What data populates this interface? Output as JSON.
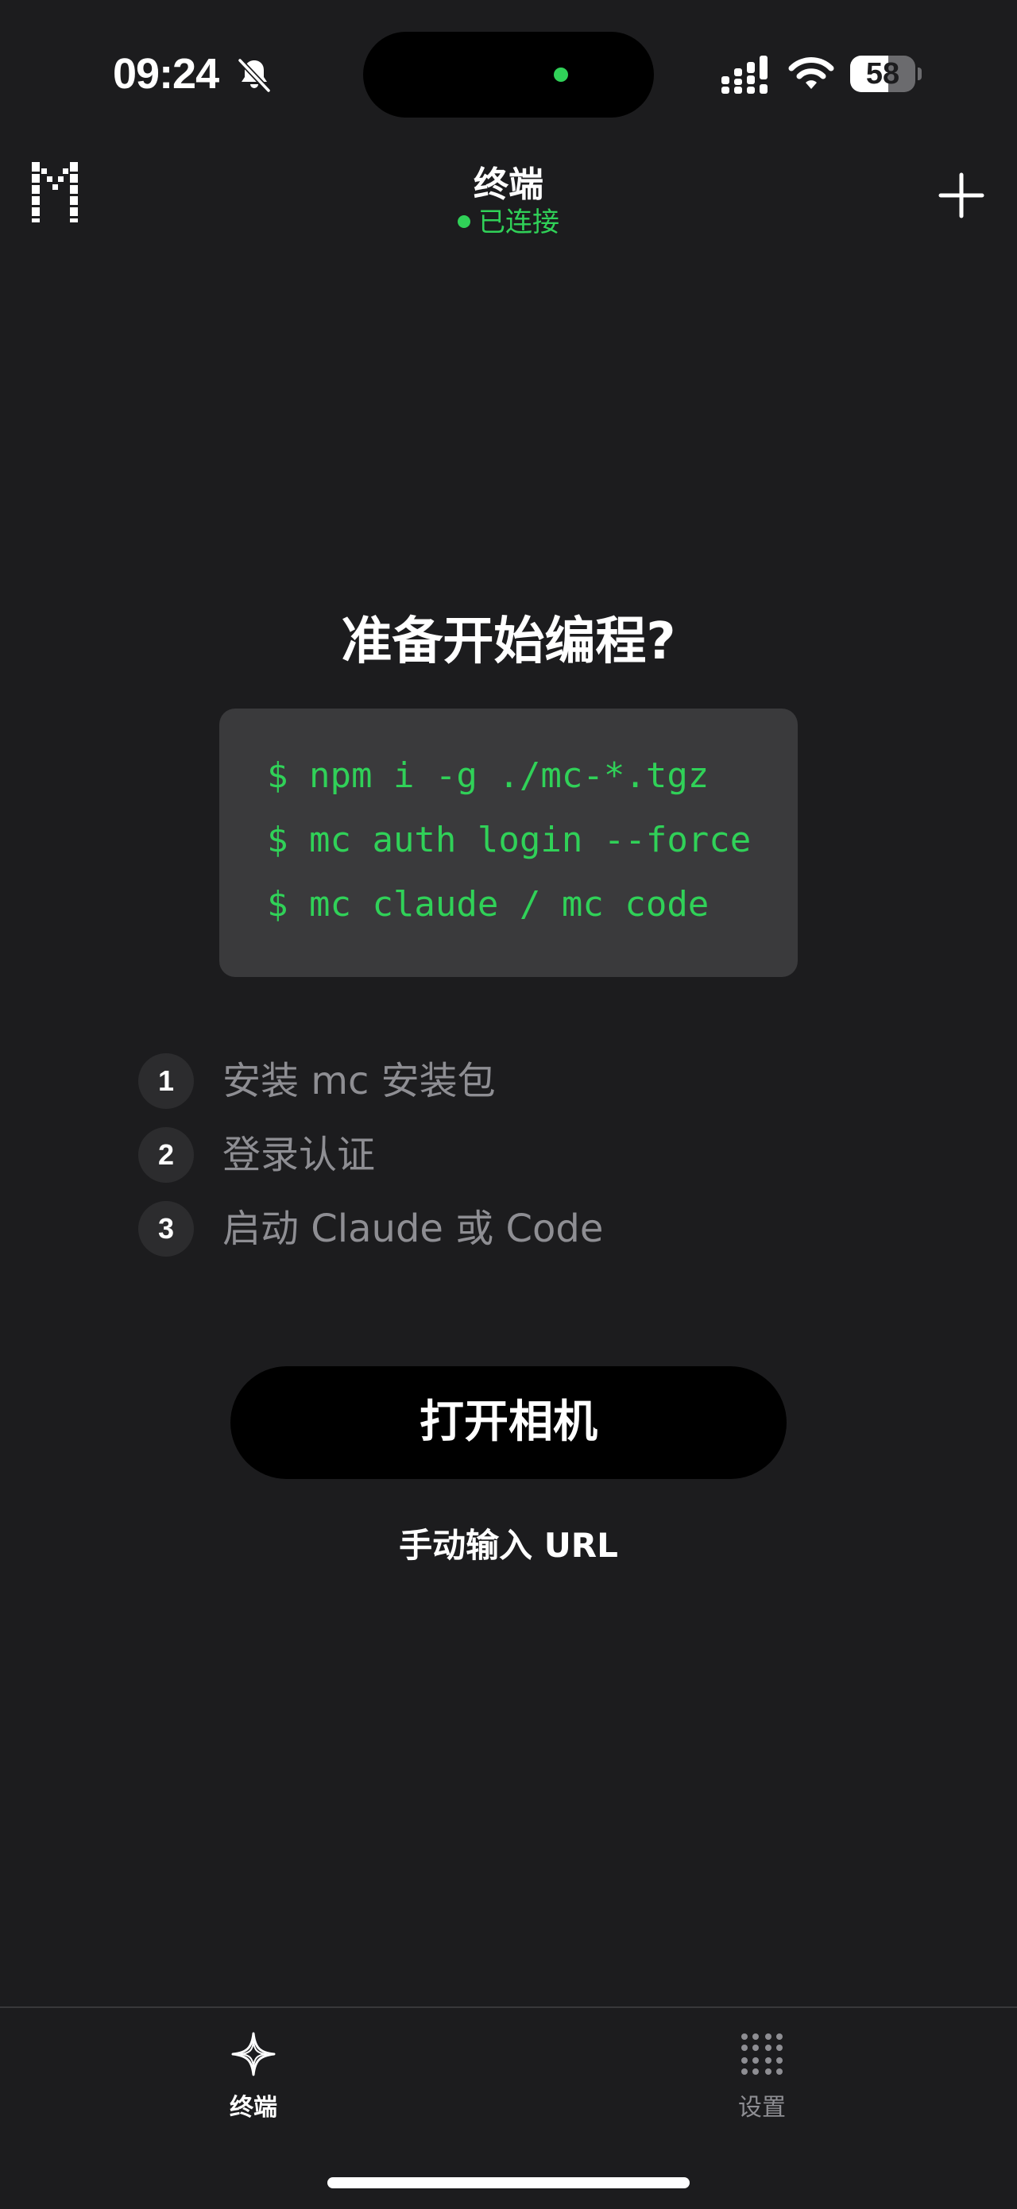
{
  "status_bar": {
    "time": "09:24",
    "battery_level": "58",
    "battery_fraction": 0.58,
    "icons": [
      "bell-slash-icon",
      "cellular-signal-icon",
      "wifi-icon",
      "battery-icon"
    ],
    "island_dot_color": "#30d158"
  },
  "header": {
    "title": "终端",
    "status": "已连接",
    "status_color": "#30d158",
    "logo_icon": "app-logo-icon",
    "add_icon": "plus-icon"
  },
  "main": {
    "title": "准备开始编程?",
    "code_lines": [
      "$ npm i -g ./mc-*.tgz",
      "$ mc auth login --force",
      "$ mc claude / mc code"
    ],
    "steps": [
      {
        "number": "1",
        "label": "安装 mc 安装包"
      },
      {
        "number": "2",
        "label": "登录认证"
      },
      {
        "number": "3",
        "label": "启动 Claude 或 Code"
      }
    ],
    "primary_button": "打开相机",
    "secondary_link": "手动输入 URL"
  },
  "tab_bar": {
    "tabs": [
      {
        "label": "终端",
        "icon": "sparkle-icon",
        "active": true
      },
      {
        "label": "设置",
        "icon": "dots-grid-icon",
        "active": false
      }
    ]
  },
  "colors": {
    "background": "#1c1c1e",
    "accent": "#30d158",
    "code_background": "#3a3a3c",
    "muted_text": "#8e8e93"
  }
}
